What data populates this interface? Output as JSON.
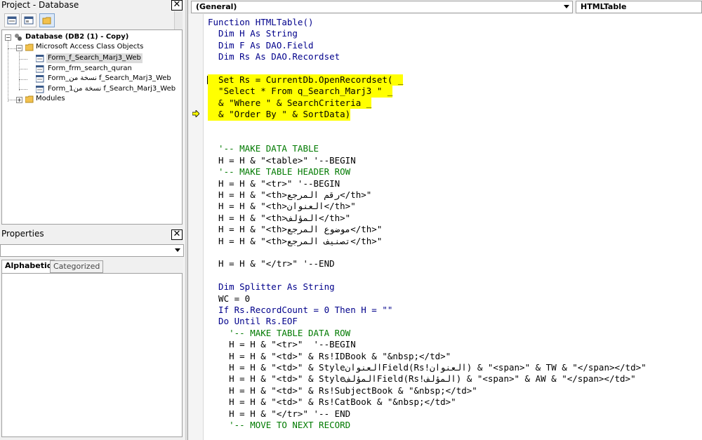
{
  "project_pane": {
    "title": "Project - Database",
    "tree": [
      {
        "label": "Database (DB2 (1) - Copy)",
        "bold": true
      },
      {
        "label": "Microsoft Access Class Objects"
      },
      {
        "label": "Form_f_Search_Marj3_Web"
      },
      {
        "label": "Form_frm_search_quran"
      },
      {
        "label": "Form_نسخة من  f_Search_Marj3_Web"
      },
      {
        "label": "Form_1نسخة من  f_Search_Marj3_Web"
      },
      {
        "label": "Modules"
      }
    ]
  },
  "properties_pane": {
    "title": "Properties",
    "tabs": [
      "Alphabetic",
      "Categorized"
    ]
  },
  "code_window": {
    "object_combo": "(General)",
    "proc_combo": "HTMLTable",
    "lines": [
      {
        "text": "Function HTMLTable()",
        "style": "kw"
      },
      {
        "text": "  Dim H As String",
        "style": "kw"
      },
      {
        "text": "  Dim F As DAO.Field",
        "style": "kw"
      },
      {
        "text": "  Dim Rs As DAO.Recordset",
        "style": "kw"
      },
      {
        "text": "",
        "style": ""
      },
      {
        "text": "  Set Rs = CurrentDb.OpenRecordset( _",
        "style": "hl"
      },
      {
        "text": "  \"Select * From q_Search_Marj3 \" _",
        "style": "hl"
      },
      {
        "text": "  & \"Where \" & SearchCriteria _",
        "style": "hl"
      },
      {
        "text": "  & \"Order By \" & SortData)",
        "style": "hl"
      },
      {
        "text": "",
        "style": ""
      },
      {
        "text": "",
        "style": ""
      },
      {
        "text": "  '-- MAKE DATA TABLE",
        "style": "cm"
      },
      {
        "text": "  H = H & \"<table>\" '--BEGIN",
        "style": ""
      },
      {
        "text": "  '-- MAKE TABLE HEADER ROW",
        "style": "cm"
      },
      {
        "text": "  H = H & \"<tr>\" '--BEGIN",
        "style": ""
      },
      {
        "text": "  H = H & \"<th>رقم المرجع</th>\"",
        "style": ""
      },
      {
        "text": "  H = H & \"<th>العنوان</th>\"",
        "style": ""
      },
      {
        "text": "  H = H & \"<th>المؤلف</th>\"",
        "style": ""
      },
      {
        "text": "  H = H & \"<th>موضوع المرجع</th>\"",
        "style": ""
      },
      {
        "text": "  H = H & \"<th>تصنيف المرجع</th>\"",
        "style": ""
      },
      {
        "text": "",
        "style": ""
      },
      {
        "text": "  H = H & \"</tr>\" '--END",
        "style": ""
      },
      {
        "text": "",
        "style": ""
      },
      {
        "text": "  Dim Splitter As String",
        "style": "kw"
      },
      {
        "text": "  WC = 0",
        "style": ""
      },
      {
        "text": "  If Rs.RecordCount = 0 Then H = \"\"",
        "style": "kw"
      },
      {
        "text": "  Do Until Rs.EOF",
        "style": "kw"
      },
      {
        "text": "    '-- MAKE TABLE DATA ROW",
        "style": "cm"
      },
      {
        "text": "    H = H & \"<tr>\"  '--BEGIN",
        "style": ""
      },
      {
        "text": "    H = H & \"<td>\" & Rs!IDBook & \"&nbsp;</td>\"",
        "style": ""
      },
      {
        "text": "    H = H & \"<td>\" & StyleالعنوانField(Rs!العنوان) & \"<span>\" & TW & \"</span></td>\"",
        "style": ""
      },
      {
        "text": "    H = H & \"<td>\" & StyleالمؤلفField(Rs!المؤلف) & \"<span>\" & AW & \"</span></td>\"",
        "style": ""
      },
      {
        "text": "    H = H & \"<td>\" & Rs!SubjectBook & \"&nbsp;</td>\"",
        "style": ""
      },
      {
        "text": "    H = H & \"<td>\" & Rs!CatBook & \"&nbsp;</td>\"",
        "style": ""
      },
      {
        "text": "    H = H & \"</tr>\" '-- END",
        "style": ""
      },
      {
        "text": "    '-- MOVE TO NEXT RECORD",
        "style": "cm"
      }
    ]
  }
}
